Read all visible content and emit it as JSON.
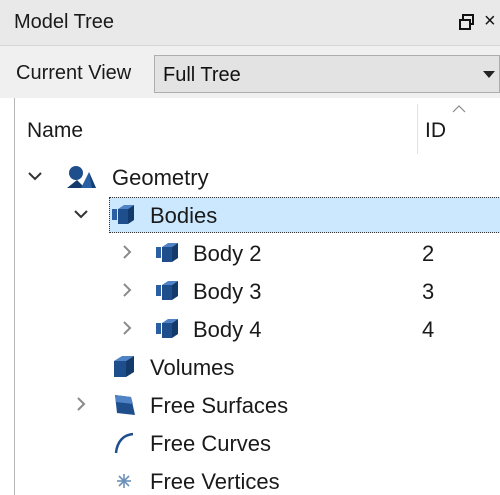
{
  "panel": {
    "title": "Model Tree",
    "close_glyph": "×"
  },
  "view": {
    "label": "Current View",
    "selected": "Full Tree"
  },
  "columns": {
    "name": "Name",
    "id": "ID"
  },
  "tree": {
    "geometry": {
      "label": "Geometry",
      "icon": "geometry-icon"
    },
    "bodies": {
      "label": "Bodies",
      "icon": "body-cube-icon"
    },
    "body2": {
      "label": "Body 2",
      "id": "2"
    },
    "body3": {
      "label": "Body 3",
      "id": "3"
    },
    "body4": {
      "label": "Body 4",
      "id": "4"
    },
    "volumes": {
      "label": "Volumes",
      "icon": "volume-cube-icon"
    },
    "free_surfaces": {
      "label": "Free Surfaces",
      "icon": "surface-icon"
    },
    "free_curves": {
      "label": "Free Curves",
      "icon": "curve-icon"
    },
    "free_vertices": {
      "label": "Free Vertices",
      "icon": "vertex-icon"
    }
  },
  "colors": {
    "selection": "#cce8ff",
    "icon_blue": "#1f4e8c",
    "header_bg": "#e9e9e9"
  }
}
